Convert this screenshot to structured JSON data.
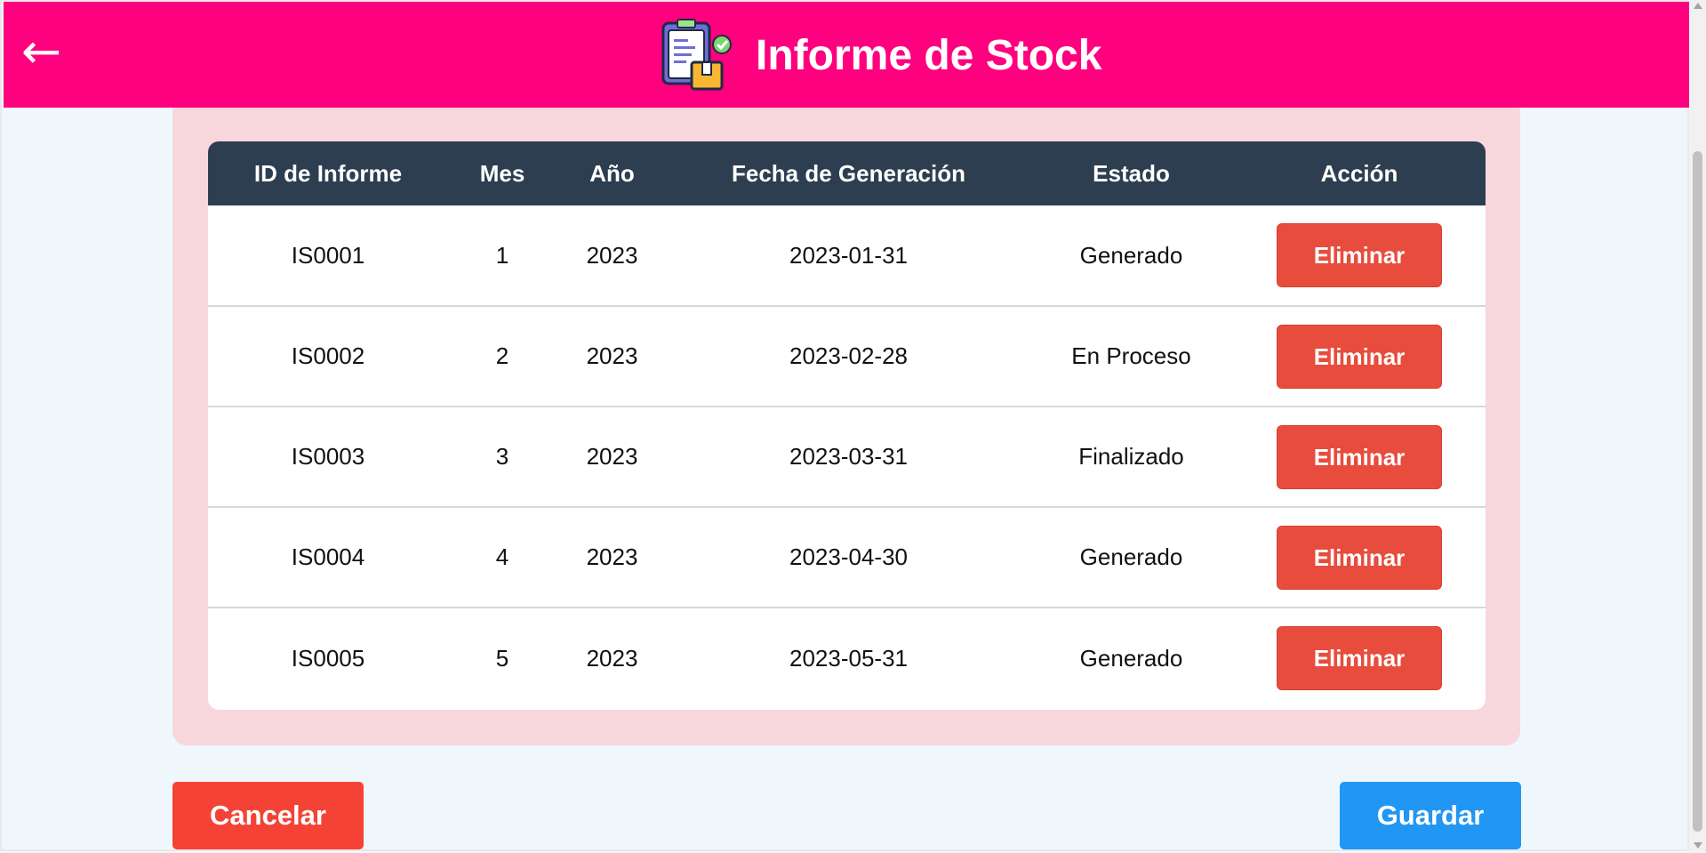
{
  "header": {
    "back_icon": "←",
    "title": "Informe de Stock",
    "logo_icon": "clipboard-box-icon",
    "background_color": "#ff007f"
  },
  "table": {
    "columns": [
      "ID de Informe",
      "Mes",
      "Año",
      "Fecha de Generación",
      "Estado",
      "Acción"
    ],
    "rows": [
      {
        "id": "IS0001",
        "mes": "1",
        "anio": "2023",
        "fecha": "2023-01-31",
        "estado": "Generado",
        "accion": "Eliminar"
      },
      {
        "id": "IS0002",
        "mes": "2",
        "anio": "2023",
        "fecha": "2023-02-28",
        "estado": "En Proceso",
        "accion": "Eliminar"
      },
      {
        "id": "IS0003",
        "mes": "3",
        "anio": "2023",
        "fecha": "2023-03-31",
        "estado": "Finalizado",
        "accion": "Eliminar"
      },
      {
        "id": "IS0004",
        "mes": "4",
        "anio": "2023",
        "fecha": "2023-04-30",
        "estado": "Generado",
        "accion": "Eliminar"
      },
      {
        "id": "IS0005",
        "mes": "5",
        "anio": "2023",
        "fecha": "2023-05-31",
        "estado": "Generado",
        "accion": "Eliminar"
      }
    ]
  },
  "footer": {
    "cancel_label": "Cancelar",
    "save_label": "Guardar"
  },
  "colors": {
    "header_bg": "#ff007f",
    "table_header_bg": "#2d3e50",
    "panel_bg": "#f7d7db",
    "delete": "#e74c3c",
    "cancel": "#f44336",
    "save": "#2196f3"
  }
}
